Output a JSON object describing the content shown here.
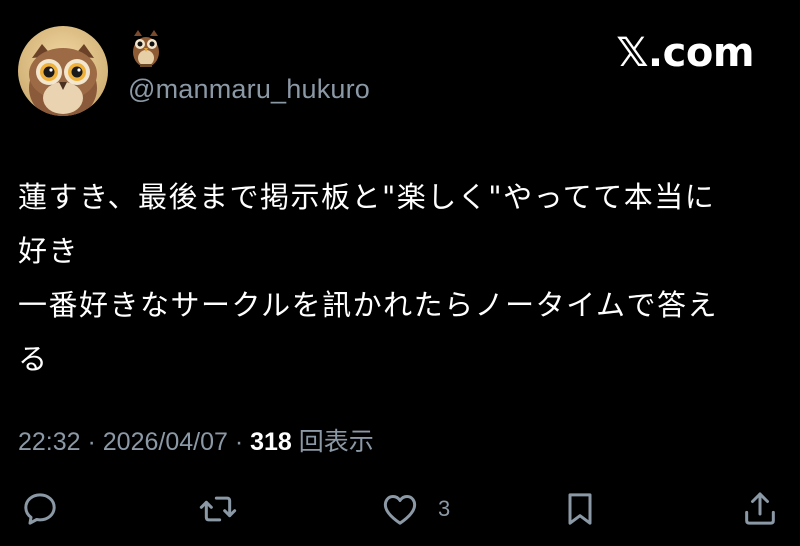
{
  "header": {
    "display_name_icon": "owl-emoji",
    "handle": "@manmaru_hukuro",
    "brand": "𝕏.com"
  },
  "tweet": {
    "lines": [
      "蓮すき、最後まで掲示板と\"楽しく\"やってて本当に",
      "好き",
      "一番好きなサークルを訊かれたらノータイムで答え",
      "る"
    ]
  },
  "meta": {
    "time": "22:32",
    "sep1": " · ",
    "date": "2026/04/07",
    "sep2": " · ",
    "views": "318",
    "views_label": " 回表示"
  },
  "actions": {
    "reply_icon": "reply-icon",
    "retweet_icon": "retweet-icon",
    "like_icon": "heart-icon",
    "like_count": "3",
    "bookmark_icon": "bookmark-icon",
    "share_icon": "share-icon"
  },
  "colors": {
    "background": "#000000",
    "text": "#ffffff",
    "secondary": "#8b98a5"
  }
}
